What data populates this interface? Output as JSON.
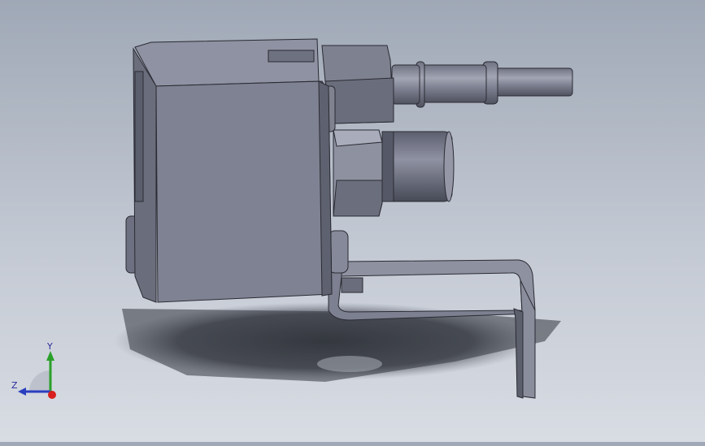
{
  "viewport": {
    "background_top": "#9fa8b6",
    "background_bottom": "#d8dce3",
    "model_color": "#8a8d9c"
  },
  "triad": {
    "x_label": "",
    "y_label": "Y",
    "z_label": "Z",
    "y_color": "#2aa02a",
    "z_color": "#2b3fbf",
    "x_color": "#d81e1e"
  }
}
